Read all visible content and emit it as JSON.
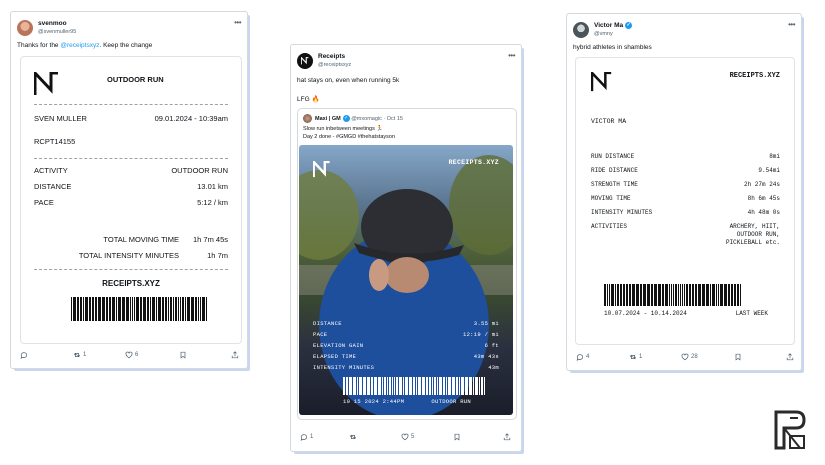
{
  "tweet1": {
    "name": "svenmoo",
    "handle": "@svenmuller95",
    "text_before": "Thanks for the ",
    "mention": "@receiptsxyz",
    "text_after": ". Keep the change",
    "receipt": {
      "title": "OUTDOOR RUN",
      "person": "SVEN MULLER",
      "datetime": "09.01.2024 - 10:39am",
      "code": "RCPT14155",
      "rows": [
        {
          "label": "ACTIVITY",
          "value": "OUTDOOR RUN"
        },
        {
          "label": "DISTANCE",
          "value": "13.01 km"
        },
        {
          "label": "PACE",
          "value": "5:12 / km"
        }
      ],
      "totals": [
        {
          "label": "TOTAL MOVING TIME",
          "value": "1h 7m 45s"
        },
        {
          "label": "TOTAL INTENSITY MINUTES",
          "value": "1h 7m"
        }
      ],
      "brand": "RECEIPTS.XYZ"
    },
    "actions": {
      "reply": "",
      "retweet": "1",
      "like": "6"
    }
  },
  "tweet2": {
    "name": "Receipts",
    "handle": "@receiptsxyz",
    "text1": "hat stays on, even when running 5k",
    "text2": "LFG 🔥",
    "quote": {
      "name": "Maxi | GM",
      "handle": "@mxomagic · Oct 15",
      "line1": "Slow run inbetween meetings 🏃",
      "line2": "Day 2 done - #GMGD #thehatstayson"
    },
    "photo": {
      "brand": "RECEIPTS.XYZ",
      "stats": [
        {
          "label": "DISTANCE",
          "value": "3.55 mi"
        },
        {
          "label": "PACE",
          "value": "12:19 / mi"
        },
        {
          "label": "ELEVATION GAIN",
          "value": "6 ft"
        },
        {
          "label": "ELAPSED TIME",
          "value": "43m 43s"
        },
        {
          "label": "INTENSITY MINUTES",
          "value": "43m"
        }
      ],
      "date": "10 15 2024 2:44PM",
      "type": "OUTDOOR RUN"
    },
    "actions": {
      "reply": "1",
      "retweet": "",
      "like": "5"
    }
  },
  "tweet3": {
    "name": "Victor Ma",
    "handle": "@vmny",
    "text": "hybrid athletes in shambles",
    "receipt": {
      "brand": "RECEIPTS.XYZ",
      "person": "VICTOR MA",
      "rows": [
        {
          "label": "RUN DISTANCE",
          "value": "8mi"
        },
        {
          "label": "RIDE DISTANCE",
          "value": "9.54mi"
        },
        {
          "label": "STRENGTH TIME",
          "value": "2h 27m 24s"
        },
        {
          "label": "MOVING TIME",
          "value": "8h 6m 45s"
        },
        {
          "label": "INTENSITY MINUTES",
          "value": "4h 48m 0s"
        }
      ],
      "activities_label": "ACTIVITIES",
      "activities": [
        "ARCHERY, HIIT,",
        "OUTDOOR RUN,",
        "PICKLEBALL etc."
      ],
      "date_range": "10.07.2024 - 10.14.2024",
      "period": "LAST WEEK"
    },
    "actions": {
      "reply": "4",
      "retweet": "1",
      "like": "28"
    }
  },
  "colors": {
    "accent_blue": "#1d9bf0",
    "shadow": "#c9d6f0"
  }
}
